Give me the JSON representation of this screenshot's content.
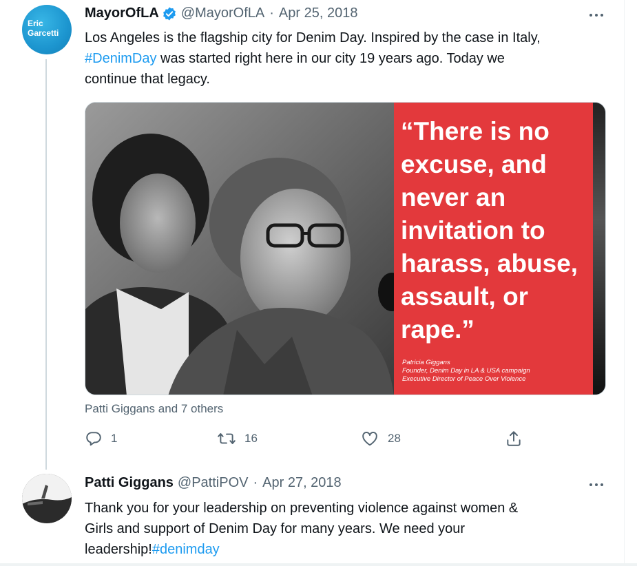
{
  "tweet1": {
    "avatar_text": [
      "Eric",
      "Garcetti"
    ],
    "name": "MayorOfLA",
    "handle": "@MayorOfLA",
    "separator": "·",
    "date": "Apr 25, 2018",
    "text_1": "Los Angeles is the flagship city for Denim Day. Inspired by the case in Italy,",
    "hashtag": "#DenimDay",
    "text_2": " was started right here in our city 19 years ago. Today we",
    "text_3": "continue that legacy.",
    "image_quote": [
      "“There is no",
      "excuse, and",
      "never an",
      "invitation to",
      "harass, abuse,",
      "assault, or",
      "rape.”"
    ],
    "image_credit": [
      "Patricia Giggans",
      "Founder, Denim Day in LA & USA campaign",
      "Executive Director of Peace Over Violence"
    ],
    "tagged": "Patti Giggans and 7 others",
    "actions": {
      "replies": "1",
      "retweets": "16",
      "likes": "28"
    }
  },
  "tweet2": {
    "name": "Patti Giggans",
    "handle": "@PattiPOV",
    "separator": "·",
    "date": "Apr 27, 2018",
    "text_1": "Thank you for your leadership on preventing violence against women  &",
    "text_2": "Girls  and support of Denim Day for many years. We need your",
    "text_3": "leadership!",
    "hashtag": "#denimday"
  },
  "colors": {
    "accent": "#1d9bf0",
    "muted": "#536471",
    "quote_red": "#e3393c"
  },
  "icons": [
    "verified-badge-icon",
    "more-icon",
    "reply-icon",
    "retweet-icon",
    "like-icon",
    "share-icon"
  ]
}
